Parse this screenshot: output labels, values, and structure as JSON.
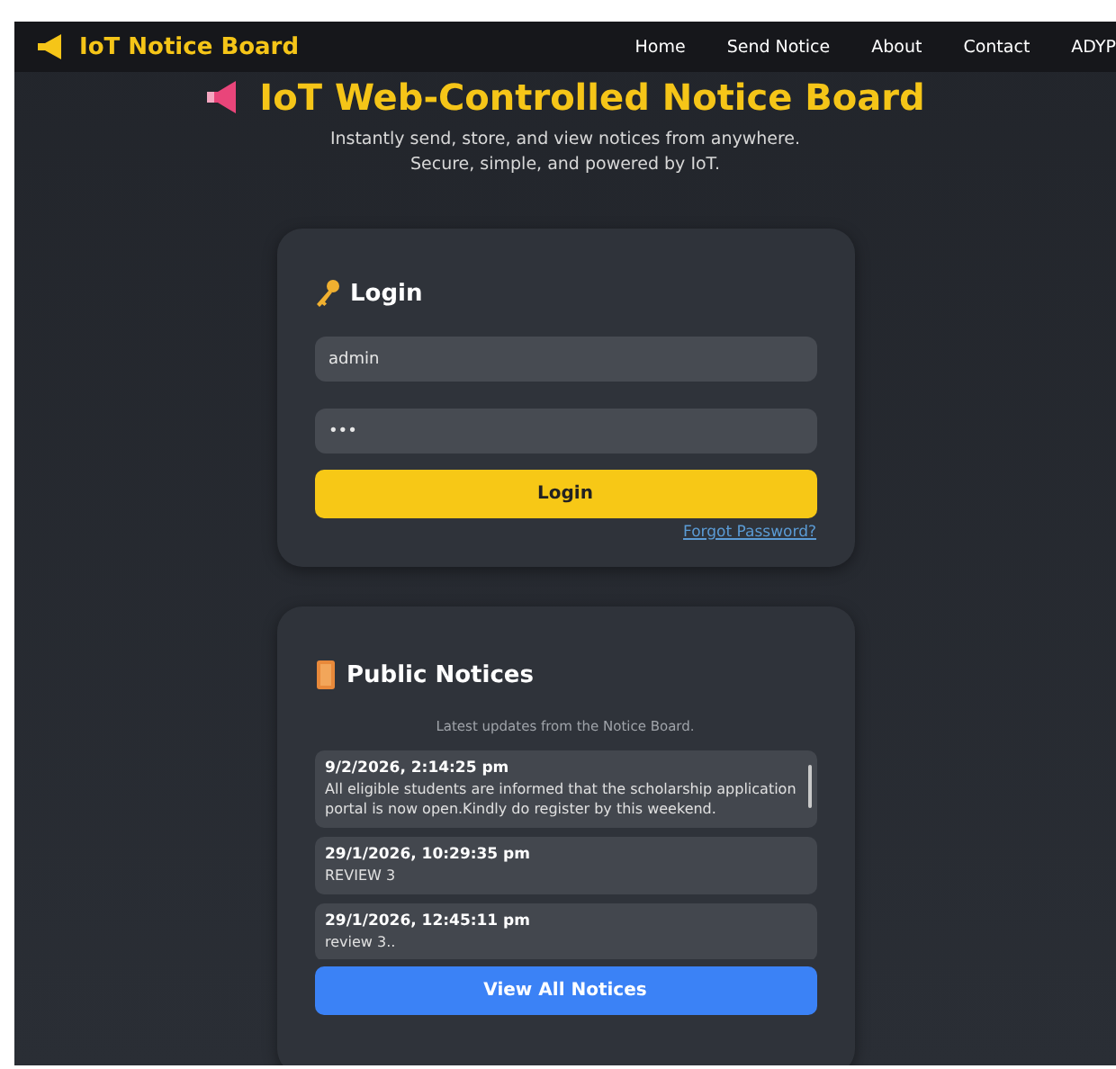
{
  "nav": {
    "brand": "IoT Notice Board",
    "links": [
      {
        "label": "Home"
      },
      {
        "label": "Send Notice"
      },
      {
        "label": "About"
      },
      {
        "label": "Contact"
      },
      {
        "label": "ADYP"
      }
    ]
  },
  "hero": {
    "title": "IoT Web-Controlled Notice Board",
    "subtitle_lines": [
      "Instantly send, store, and view notices from anywhere.",
      "Secure, simple, and powered by IoT."
    ]
  },
  "login": {
    "heading": "Login",
    "username": {
      "value": "admin"
    },
    "password": {
      "value": "•••"
    },
    "button": "Login",
    "forgot_link": "Forgot Password?"
  },
  "notices": {
    "heading": "Public Notices",
    "subtitle": "Latest updates from the Notice Board.",
    "items": [
      {
        "time": "9/2/2026, 2:14:25 pm",
        "text": "All eligible students are informed that the scholarship application portal is now open.Kindly do register by this weekend."
      },
      {
        "time": "29/1/2026, 10:29:35 pm",
        "text": "REVIEW 3"
      },
      {
        "time": "29/1/2026, 12:45:11 pm",
        "text": "review 3.."
      }
    ],
    "button": "View All Notices"
  }
}
